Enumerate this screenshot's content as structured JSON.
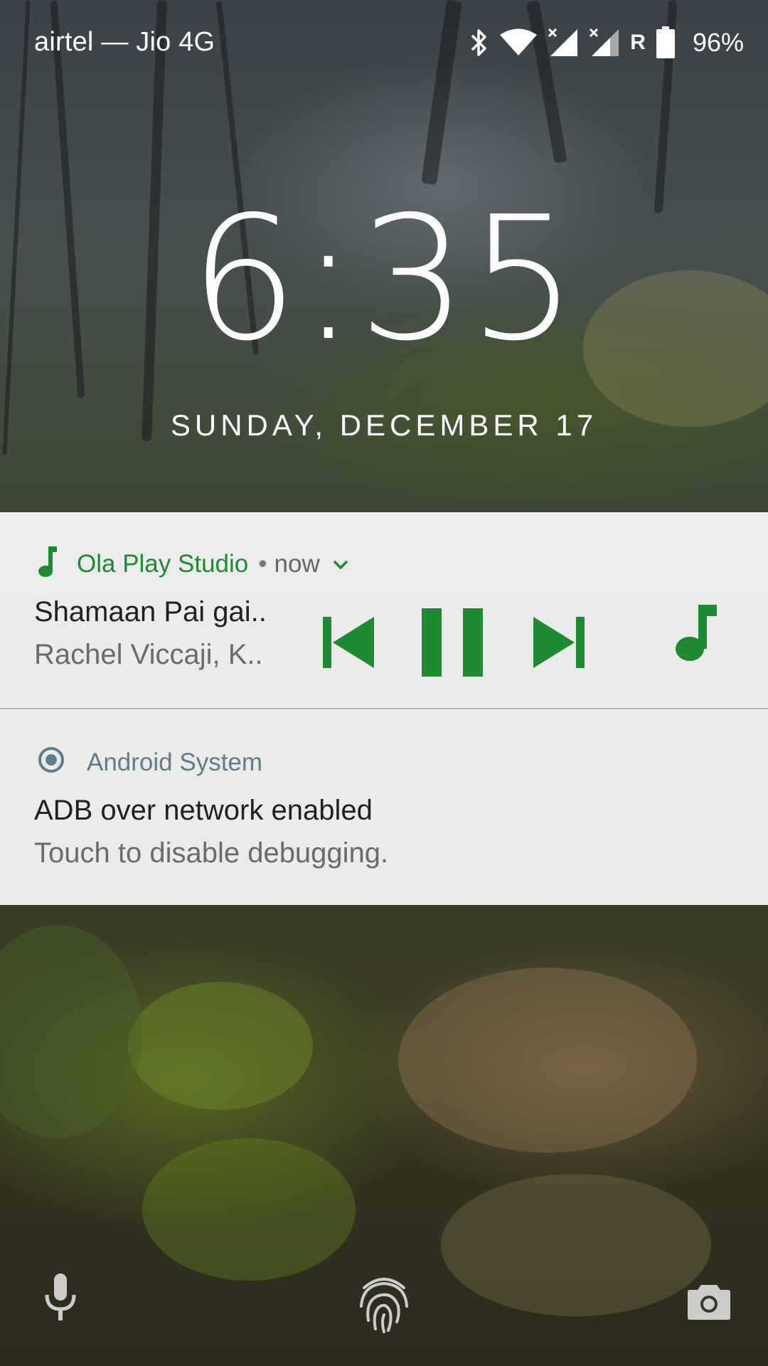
{
  "status_bar": {
    "carrier": "airtel — Jio 4G",
    "roaming_label": "R",
    "battery_percent": "96%",
    "icons": [
      "bluetooth-icon",
      "wifi-icon",
      "signal-1-icon",
      "signal-2-icon",
      "battery-icon"
    ]
  },
  "lock_screen": {
    "time": "6:35",
    "date": "SUNDAY, DECEMBER 17"
  },
  "media_notification": {
    "app_name": "Ola Play Studio",
    "separator": "•",
    "time_ago": "now",
    "track_title": "Shamaan Pai gai..",
    "artist": "Rachel Viccaji, K..",
    "accent_color": "#1e8a33",
    "controls": [
      "previous-icon",
      "pause-icon",
      "next-icon"
    ]
  },
  "system_notification": {
    "app_name": "Android System",
    "title": "ADB over network enabled",
    "message": "Touch to disable debugging.",
    "accent_color": "#5f7d8c"
  },
  "bottom_bar": {
    "icons": [
      "microphone-icon",
      "fingerprint-icon",
      "camera-icon"
    ]
  }
}
